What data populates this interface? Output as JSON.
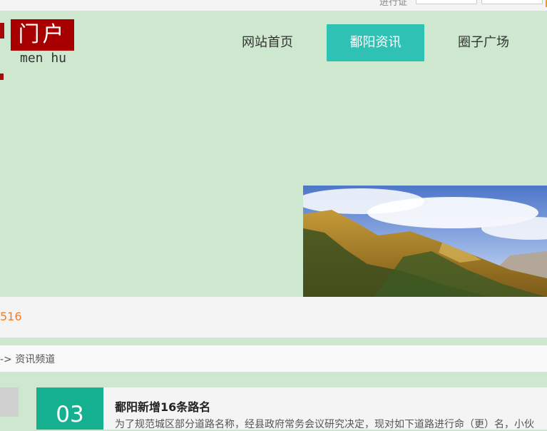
{
  "topbar": {
    "label": "进行证"
  },
  "logo": {
    "main": "门户",
    "sub": "men hu"
  },
  "nav": {
    "home": "网站首页",
    "news": "鄱阳资讯",
    "circle": "圈子广场"
  },
  "ticker": {
    "number": "516"
  },
  "breadcrumb": {
    "text": "-> 资讯频道"
  },
  "article": {
    "day": "03",
    "title": "鄱阳新增16条路名",
    "desc": "为了规范城区部分道路名称，经县政府常务会议研究决定，现对如下道路进行命（更）名，小伙"
  },
  "colors": {
    "nav_active": "#2fc2b4",
    "date_bg": "#14b08f",
    "logo_red": "#a80000",
    "accent_orange": "#f07d28",
    "page_bg": "#cde8cf"
  }
}
